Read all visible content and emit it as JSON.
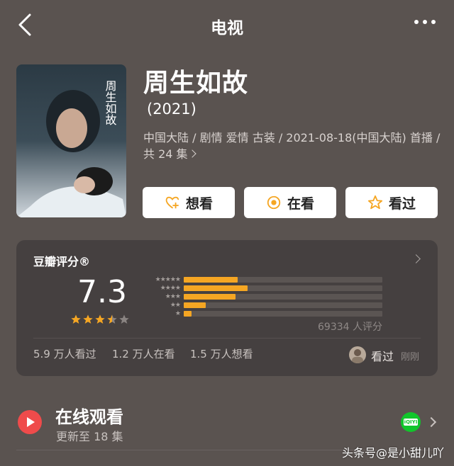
{
  "nav": {
    "title": "电视",
    "back_icon": "back-icon",
    "more_icon": "more-icon"
  },
  "movie": {
    "title": "周生如故",
    "year": "(2021)",
    "meta": "中国大陆 / 剧情 爱情 古装 / 2021-08-18(中国大陆) 首播 / 共 24 集",
    "poster_text": "周生如故"
  },
  "actions": [
    {
      "label": "想看",
      "icon": "heart-plus-icon"
    },
    {
      "label": "在看",
      "icon": "watching-icon"
    },
    {
      "label": "看过",
      "icon": "star-icon"
    }
  ],
  "rating": {
    "title": "豆瓣评分®",
    "score": "7.3",
    "star_value": 3.5,
    "count": "69334 人评分",
    "distribution": [
      {
        "stars": 5,
        "fraction": 0.27
      },
      {
        "stars": 4,
        "fraction": 0.32
      },
      {
        "stars": 3,
        "fraction": 0.26
      },
      {
        "stars": 2,
        "fraction": 0.11
      },
      {
        "stars": 1,
        "fraction": 0.04
      }
    ],
    "stats": {
      "watched": "5.9 万人看过",
      "watching": "1.2 万人在看",
      "want": "1.5 万人想看"
    },
    "my_status": "看过",
    "time": "刚刚"
  },
  "online": {
    "title": "在线观看",
    "subtitle": "更新至 18 集",
    "platform": "iQIYI"
  },
  "watermark": "头条号@是小甜儿吖",
  "colors": {
    "bar": "#f5a623",
    "star": "#f5a623",
    "play": "#ef4b4b",
    "iqiyi": "#11c52b"
  }
}
